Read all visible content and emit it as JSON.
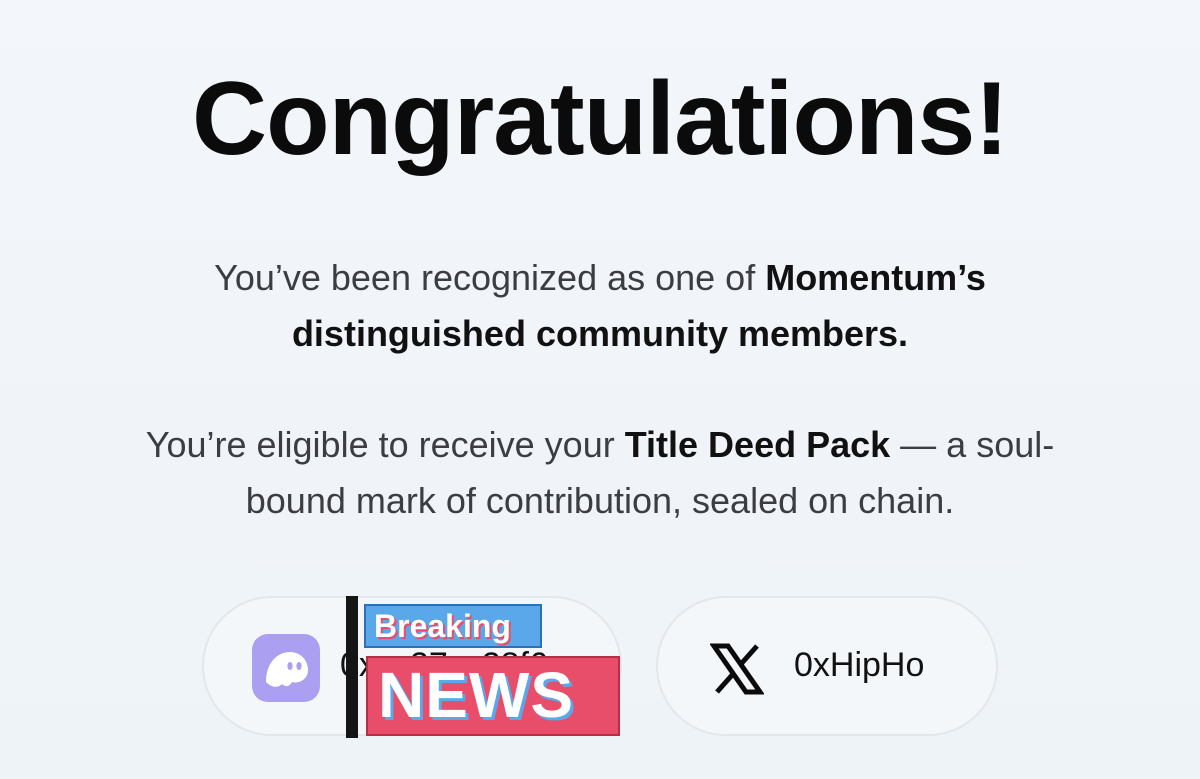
{
  "heading": "Congratulations!",
  "recognition": {
    "prefix": "You’ve been recognized as one of ",
    "brand": "Momentum’s",
    "line2": "distinguished community members."
  },
  "eligibility": {
    "prefix": "You’re eligible to receive your ",
    "item": "Title Deed Pack",
    "suffix_line1": " — a soul-",
    "line2": "bound mark of contribution, sealed on chain."
  },
  "wallet_account": {
    "icon": "ghost-wallet-icon",
    "partial_address": "0x…27…28f6"
  },
  "x_account": {
    "icon": "x-logo-icon",
    "handle": "0xHipHo"
  },
  "overlay": {
    "top_label": "Breaking",
    "bottom_label": "NEWS"
  },
  "colors": {
    "background": "#f1f5f9",
    "wallet_accent": "#ab9ff2",
    "news_blue": "#5aa8ea",
    "news_pink": "#e84d6a"
  }
}
